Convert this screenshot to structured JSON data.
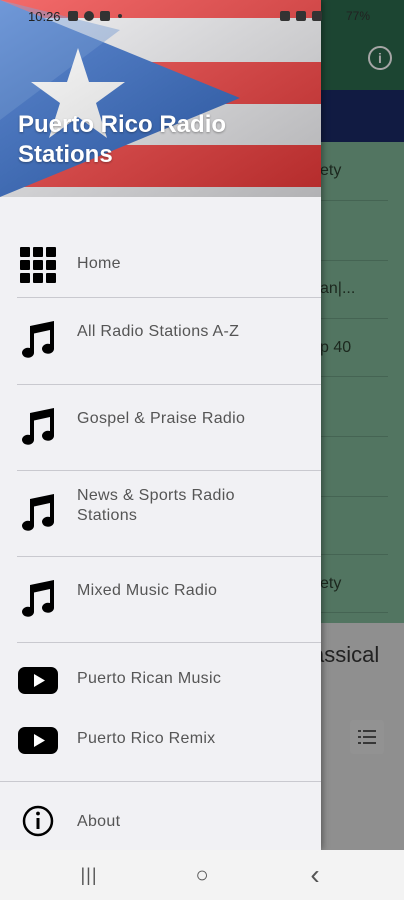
{
  "status_bar": {
    "time": "10:26",
    "battery": "77%"
  },
  "background_app": {
    "visible_fragments": [
      "ety",
      "an|...",
      "p 40",
      "ety"
    ],
    "big_text": "assical"
  },
  "drawer": {
    "header_title": "Puerto Rico Radio Stations",
    "items": [
      {
        "label": "Home",
        "icon": "grid-icon"
      },
      {
        "label": "All Radio Stations A-Z",
        "icon": "music-note-icon"
      },
      {
        "label": "Gospel & Praise Radio",
        "icon": "music-note-icon"
      },
      {
        "label": "News & Sports Radio Stations",
        "icon": "music-note-icon"
      },
      {
        "label": "Mixed Music Radio",
        "icon": "music-note-icon"
      },
      {
        "label": "Puerto Rican Music",
        "icon": "youtube-icon"
      },
      {
        "label": "Puerto Rico Remix",
        "icon": "youtube-icon"
      },
      {
        "label": "About",
        "icon": "info-icon"
      }
    ]
  },
  "nav_bar": {
    "recent": "|||",
    "home": "○",
    "back": "‹"
  }
}
